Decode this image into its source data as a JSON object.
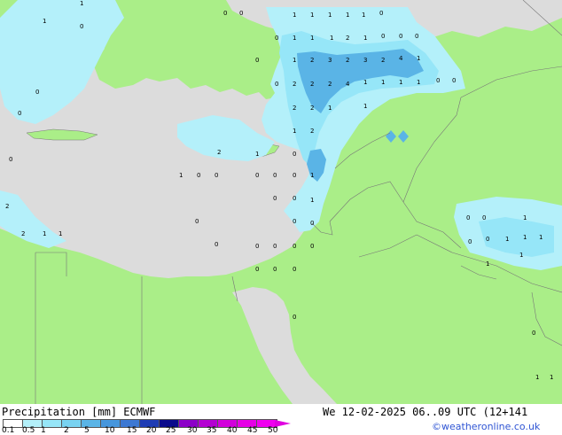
{
  "header": {
    "title": "Precipitation [mm]",
    "model": "ECMWF",
    "valid_time": "We 12-02-2025 06..09 UTC (12+141",
    "credit": "©weatheronline.co.uk"
  },
  "colorbar": {
    "ticks": [
      "0.1",
      "0.5",
      "1",
      "2",
      "5",
      "10",
      "15",
      "20",
      "25",
      "30",
      "35",
      "40",
      "45",
      "50"
    ],
    "colors": [
      "#ffffff",
      "#b4f0fa",
      "#96e6f8",
      "#78d2f0",
      "#5ab4e6",
      "#4696dc",
      "#3c78d2",
      "#1e3cb4",
      "#0a0a8c",
      "#8c00c8",
      "#b400d2",
      "#d200dc",
      "#e600e6",
      "#f000f0"
    ]
  },
  "map": {
    "colors": {
      "land": "#aaee88",
      "sea": "#dcdcdc",
      "light_precip": "#b4f0fa",
      "medium_precip": "#96e6f8",
      "heavy_precip": "#5ab4e6",
      "border": "#777777"
    },
    "labels": [
      "0",
      "0",
      "1",
      "1",
      "1",
      "1",
      "1",
      "0",
      "0",
      "1",
      "1",
      "1",
      "2",
      "1",
      "0",
      "0",
      "0",
      "0",
      "1",
      "2",
      "3",
      "2",
      "3",
      "2",
      "4",
      "1",
      "0",
      "2",
      "2",
      "2",
      "4",
      "1",
      "1",
      "1",
      "1",
      "0",
      "0",
      "0",
      "0",
      "2",
      "1",
      "1",
      "2",
      "1",
      "2",
      "1",
      "0",
      "2",
      "1",
      "0",
      "0",
      "0",
      "0",
      "0",
      "1",
      "0",
      "0",
      "1",
      "0",
      "0",
      "0",
      "0",
      "0",
      "0",
      "0",
      "0",
      "0",
      "0",
      "0",
      "0",
      "0",
      "0",
      "1",
      "1",
      "1",
      "1",
      "1",
      "0",
      "1",
      "2",
      "1",
      "1",
      "1",
      "1",
      "1",
      "0",
      "0",
      "0",
      "0",
      "2",
      "1"
    ]
  }
}
